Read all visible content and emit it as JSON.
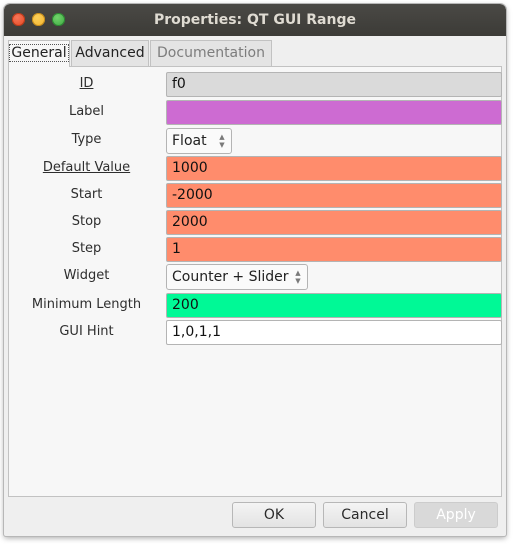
{
  "window": {
    "title": "Properties: QT GUI Range"
  },
  "tabs": [
    {
      "label": "General",
      "state": "active"
    },
    {
      "label": "Advanced",
      "state": "normal"
    },
    {
      "label": "Documentation",
      "state": "disabled"
    }
  ],
  "fields": {
    "id": {
      "label": "ID",
      "value": "f0",
      "color": "#dadada"
    },
    "label": {
      "label": "Label",
      "value": "",
      "color": "#cd6bd2"
    },
    "type": {
      "label": "Type",
      "value": "Float"
    },
    "default_value": {
      "label": "Default Value",
      "value": "1000",
      "color": "#ff8c6c"
    },
    "start": {
      "label": "Start",
      "value": "-2000",
      "color": "#ff8c6c"
    },
    "stop": {
      "label": "Stop",
      "value": "2000",
      "color": "#ff8c6c"
    },
    "step": {
      "label": "Step",
      "value": "1",
      "color": "#ff8c6c"
    },
    "widget": {
      "label": "Widget",
      "value": "Counter + Slider"
    },
    "minimum_length": {
      "label": "Minimum Length",
      "value": "200",
      "color": "#00f996"
    },
    "gui_hint": {
      "label": "GUI Hint",
      "value": "1,0,1,1",
      "color": "#ffffff"
    }
  },
  "buttons": {
    "ok": "OK",
    "cancel": "Cancel",
    "apply": "Apply"
  }
}
